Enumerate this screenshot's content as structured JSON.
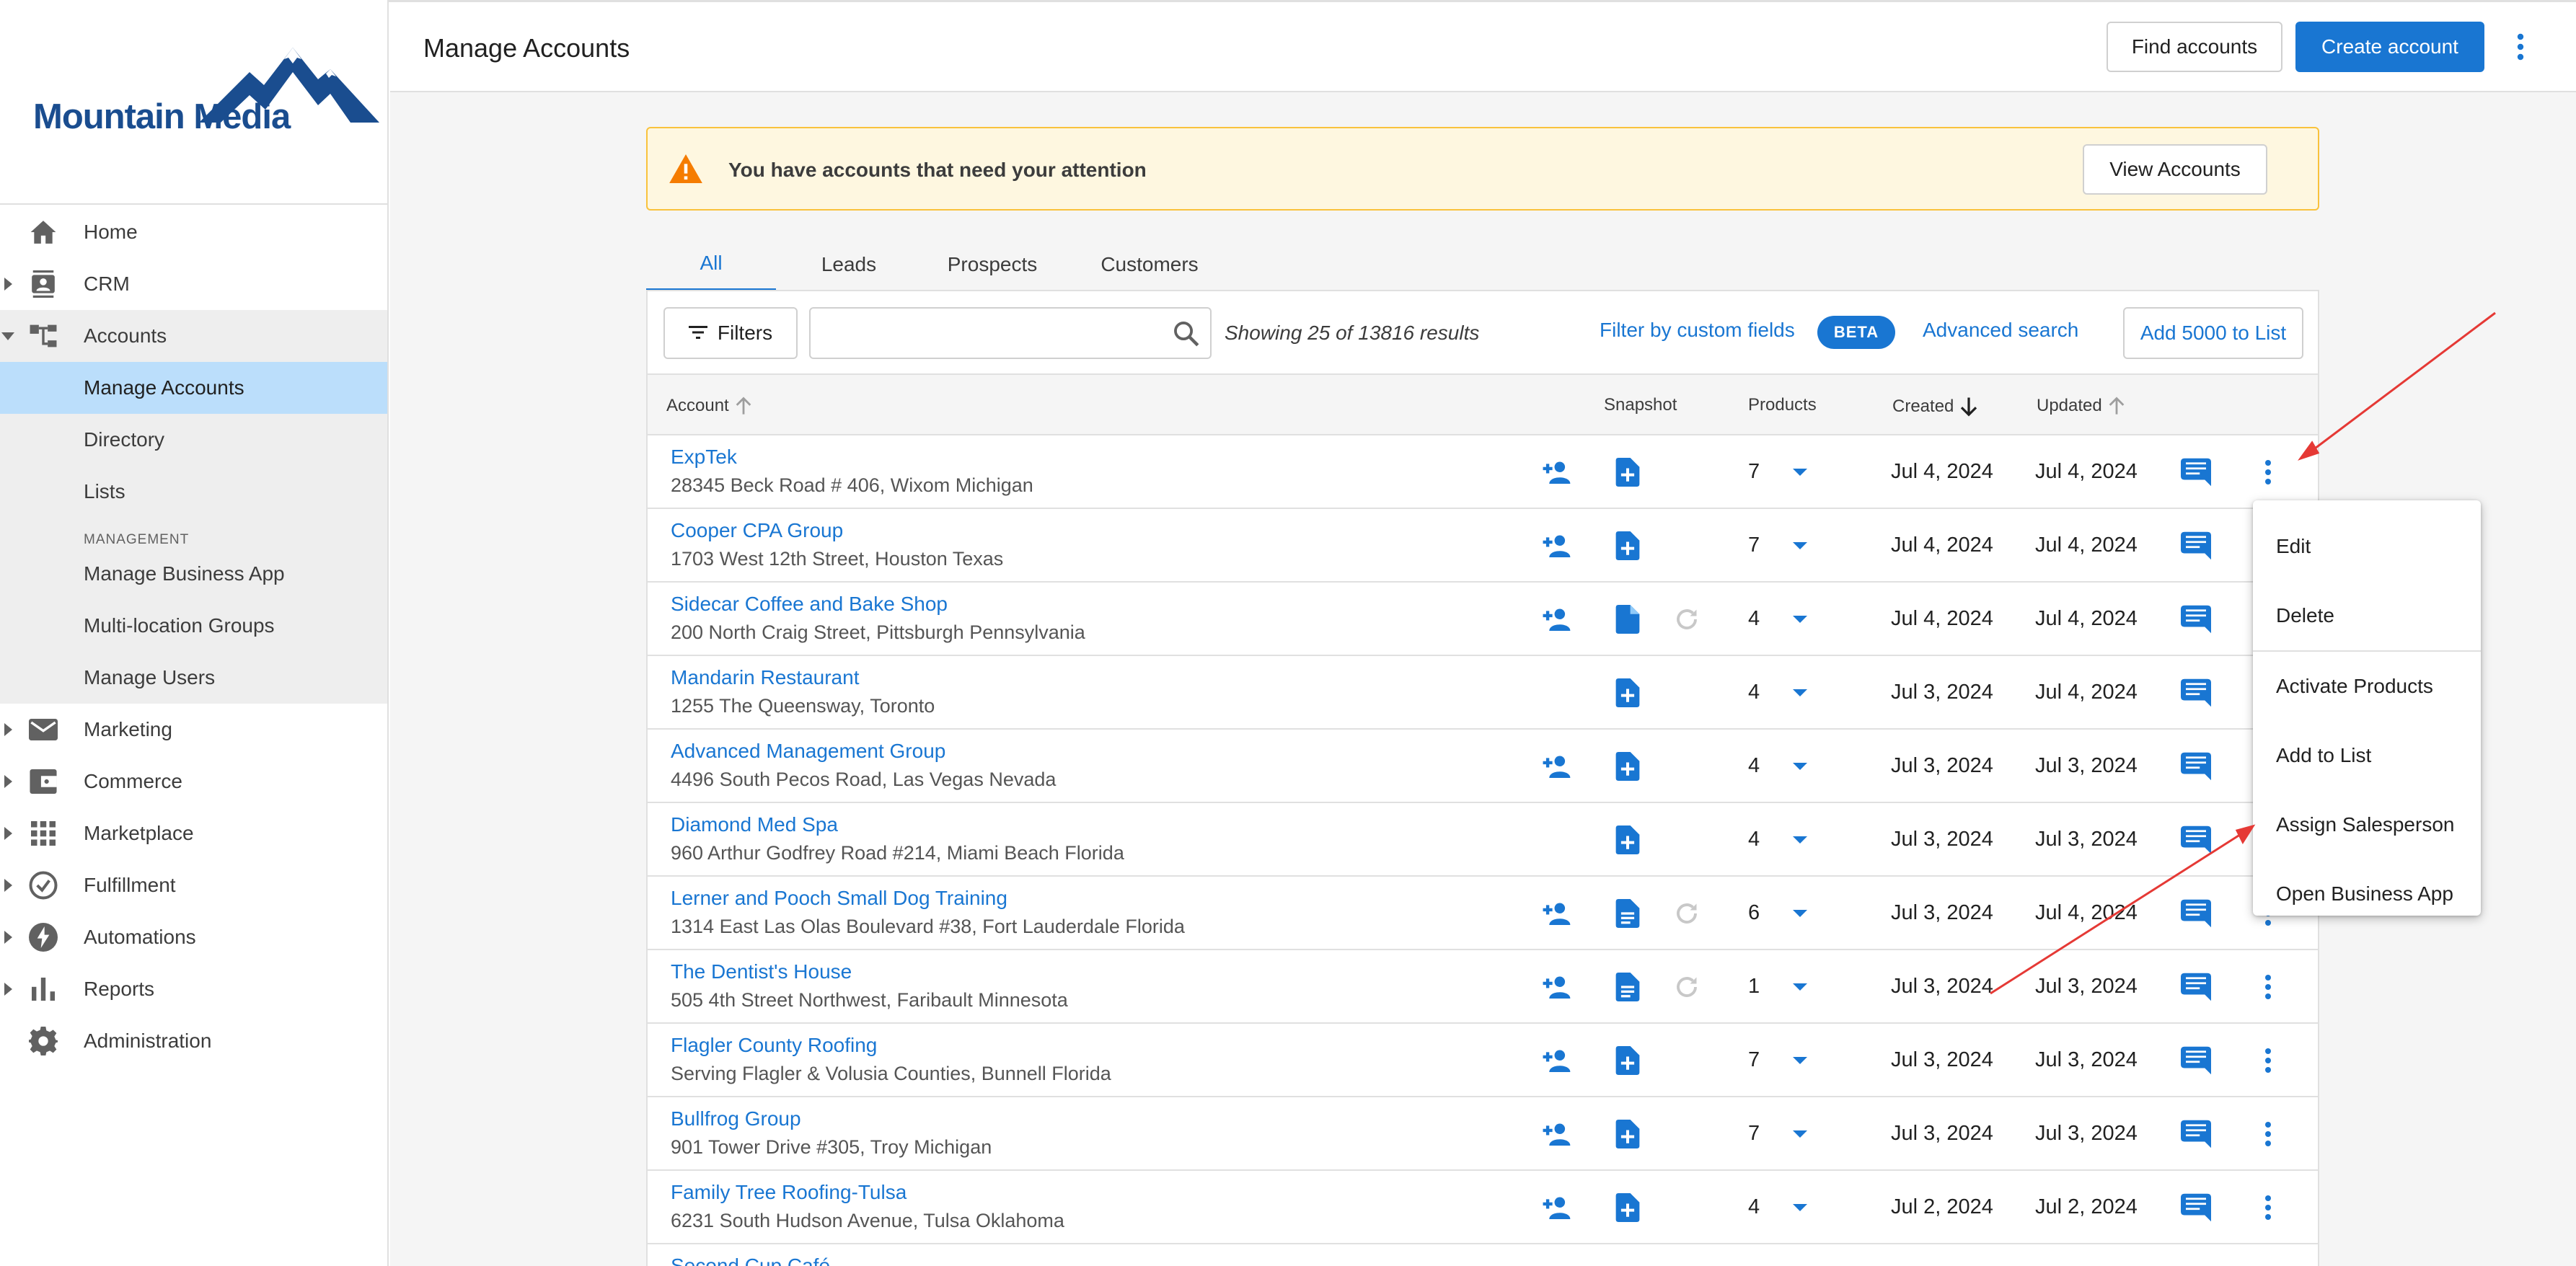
{
  "brand": {
    "name": "Mountain Media",
    "color": "#1a4d8f"
  },
  "colors": {
    "primary": "#1976d2",
    "alert_bg": "#fef7e0",
    "alert_border": "#f9c23c",
    "warning": "#f57c00",
    "annotation": "#e53935"
  },
  "sidebar": {
    "items": [
      {
        "label": "Home",
        "icon": "home-icon",
        "expandable": false
      },
      {
        "label": "CRM",
        "icon": "contacts-icon",
        "expandable": true
      },
      {
        "label": "Accounts",
        "icon": "account-tree-icon",
        "expandable": true,
        "expanded": true
      }
    ],
    "accounts_sub": {
      "manage_accounts": "Manage Accounts",
      "directory": "Directory",
      "lists": "Lists",
      "management_heading": "MANAGEMENT",
      "manage_business_app": "Manage Business App",
      "multi_location_groups": "Multi-location Groups",
      "manage_users": "Manage Users"
    },
    "items_after": [
      {
        "label": "Marketing",
        "icon": "mail-icon"
      },
      {
        "label": "Commerce",
        "icon": "wallet-icon"
      },
      {
        "label": "Marketplace",
        "icon": "apps-grid-icon"
      },
      {
        "label": "Fulfillment",
        "icon": "check-circle-icon"
      },
      {
        "label": "Automations",
        "icon": "bolt-icon"
      },
      {
        "label": "Reports",
        "icon": "bar-chart-icon"
      },
      {
        "label": "Administration",
        "icon": "gear-icon"
      }
    ]
  },
  "header": {
    "title": "Manage Accounts",
    "find_accounts": "Find accounts",
    "create_account": "Create account"
  },
  "alert": {
    "message": "You have accounts that need your attention",
    "button": "View Accounts"
  },
  "tabs": [
    "All",
    "Leads",
    "Prospects",
    "Customers"
  ],
  "toolbar": {
    "filters": "Filters",
    "search_placeholder": "",
    "results": "Showing 25 of 13816 results",
    "filter_custom": "Filter by custom fields",
    "beta": "BETA",
    "advanced_search": "Advanced search",
    "add_to_list": "Add 5000 to List"
  },
  "columns": {
    "account": "Account",
    "snapshot": "Snapshot",
    "products": "Products",
    "created": "Created",
    "updated": "Updated"
  },
  "rows": [
    {
      "name": "ExpTek",
      "address": "28345 Beck Road # 406, Wixom Michigan",
      "products": "7",
      "created": "Jul 4, 2024",
      "updated": "Jul 4, 2024",
      "salesperson": true,
      "snapshot": "add",
      "refresh": false
    },
    {
      "name": "Cooper CPA Group",
      "address": "1703 West 12th Street, Houston Texas",
      "products": "7",
      "created": "Jul 4, 2024",
      "updated": "Jul 4, 2024",
      "salesperson": true,
      "snapshot": "add",
      "refresh": false
    },
    {
      "name": "Sidecar Coffee and Bake Shop",
      "address": "200 North Craig Street, Pittsburgh Pennsylvania",
      "products": "4",
      "created": "Jul 4, 2024",
      "updated": "Jul 4, 2024",
      "salesperson": true,
      "snapshot": "plain",
      "refresh": true
    },
    {
      "name": "Mandarin Restaurant",
      "address": "1255 The Queensway, Toronto",
      "products": "4",
      "created": "Jul 3, 2024",
      "updated": "Jul 4, 2024",
      "salesperson": false,
      "snapshot": "add",
      "refresh": false
    },
    {
      "name": "Advanced Management Group",
      "address": "4496 South Pecos Road, Las Vegas Nevada",
      "products": "4",
      "created": "Jul 3, 2024",
      "updated": "Jul 3, 2024",
      "salesperson": true,
      "snapshot": "add",
      "refresh": false
    },
    {
      "name": "Diamond Med Spa",
      "address": "960 Arthur Godfrey Road #214, Miami Beach Florida",
      "products": "4",
      "created": "Jul 3, 2024",
      "updated": "Jul 3, 2024",
      "salesperson": false,
      "snapshot": "add",
      "refresh": false
    },
    {
      "name": "Lerner and Pooch Small Dog Training",
      "address": "1314 East Las Olas Boulevard #38, Fort Lauderdale Florida",
      "products": "6",
      "created": "Jul 3, 2024",
      "updated": "Jul 4, 2024",
      "salesperson": true,
      "snapshot": "lines",
      "refresh": true
    },
    {
      "name": "The Dentist's House",
      "address": "505 4th Street Northwest, Faribault Minnesota",
      "products": "1",
      "created": "Jul 3, 2024",
      "updated": "Jul 3, 2024",
      "salesperson": true,
      "snapshot": "lines",
      "refresh": true
    },
    {
      "name": "Flagler County Roofing",
      "address": "Serving Flagler & Volusia Counties, Bunnell Florida",
      "products": "7",
      "created": "Jul 3, 2024",
      "updated": "Jul 3, 2024",
      "salesperson": true,
      "snapshot": "add",
      "refresh": false
    },
    {
      "name": "Bullfrog Group",
      "address": "901 Tower Drive #305, Troy Michigan",
      "products": "7",
      "created": "Jul 3, 2024",
      "updated": "Jul 3, 2024",
      "salesperson": true,
      "snapshot": "add",
      "refresh": false
    },
    {
      "name": "Family Tree Roofing-Tulsa",
      "address": "6231 South Hudson Avenue, Tulsa Oklahoma",
      "products": "4",
      "created": "Jul 2, 2024",
      "updated": "Jul 2, 2024",
      "salesperson": true,
      "snapshot": "add",
      "refresh": false
    },
    {
      "name": "Second Cup Café",
      "address": "",
      "products": "",
      "created": "",
      "updated": "",
      "salesperson": false,
      "snapshot": "none",
      "refresh": false
    }
  ],
  "context_menu": {
    "items": [
      "Edit",
      "Delete",
      "Activate Products",
      "Add to List",
      "Assign Salesperson",
      "Open Business App"
    ]
  }
}
